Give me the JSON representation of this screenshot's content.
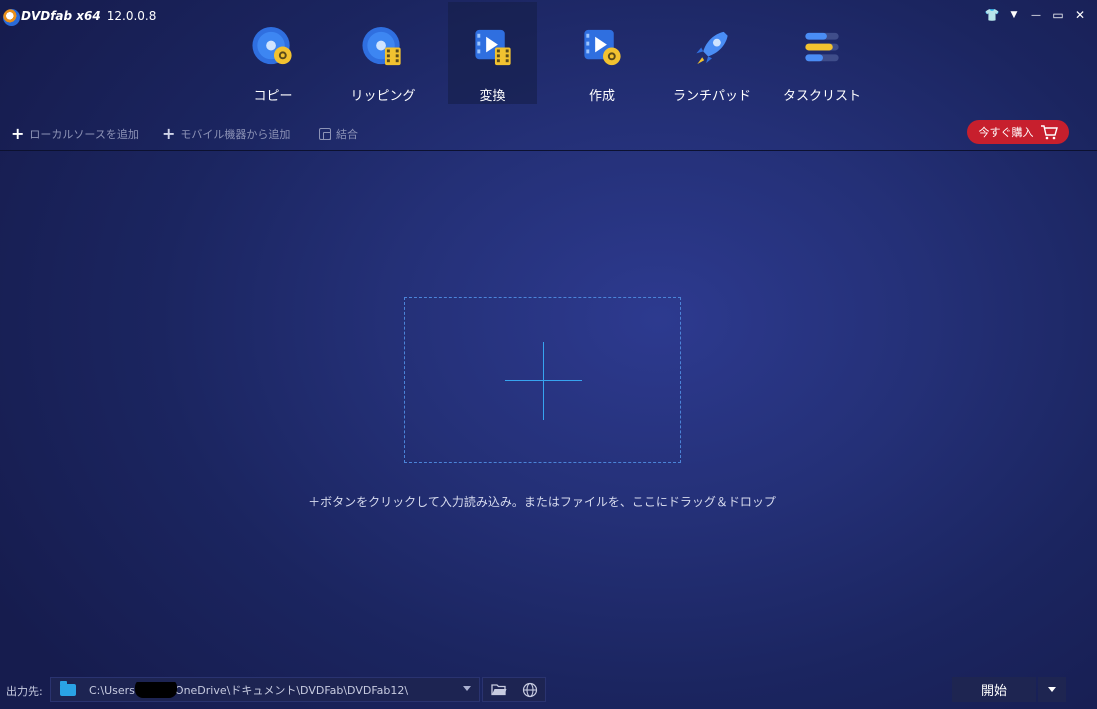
{
  "app": {
    "brand": "DVDfab x64",
    "version": "12.0.0.8"
  },
  "window_controls": {
    "skin": "👕",
    "menu": "▼",
    "minimize": "—",
    "maximize": "▭",
    "close": "✕"
  },
  "nav": [
    {
      "label": "コピー",
      "icon": "disc-copy-icon"
    },
    {
      "label": "リッピング",
      "icon": "disc-film-icon"
    },
    {
      "label": "変換",
      "icon": "video-convert-icon",
      "active": true
    },
    {
      "label": "作成",
      "icon": "video-create-icon"
    },
    {
      "label": "ランチパッド",
      "icon": "rocket-icon"
    },
    {
      "label": "タスクリスト",
      "icon": "task-list-icon"
    }
  ],
  "toolbar": {
    "add_local": "ローカルソースを追加",
    "add_mobile": "モバイル機器から追加",
    "merge": "結合",
    "buy": "今すぐ購入"
  },
  "main": {
    "hint": "＋ボタンをクリックして入力読み込み。またはファイルを、ここにドラッグ＆ドロップ"
  },
  "bottom": {
    "output_label": "出力先:",
    "path_prefix": "C:\\Users",
    "path_suffix": "OneDrive\\ドキュメント\\DVDFab\\DVDFab12\\",
    "start": "開始"
  },
  "colors": {
    "accent": "#37a4f0",
    "buy": "#c71f2d",
    "bg": "#243077"
  }
}
